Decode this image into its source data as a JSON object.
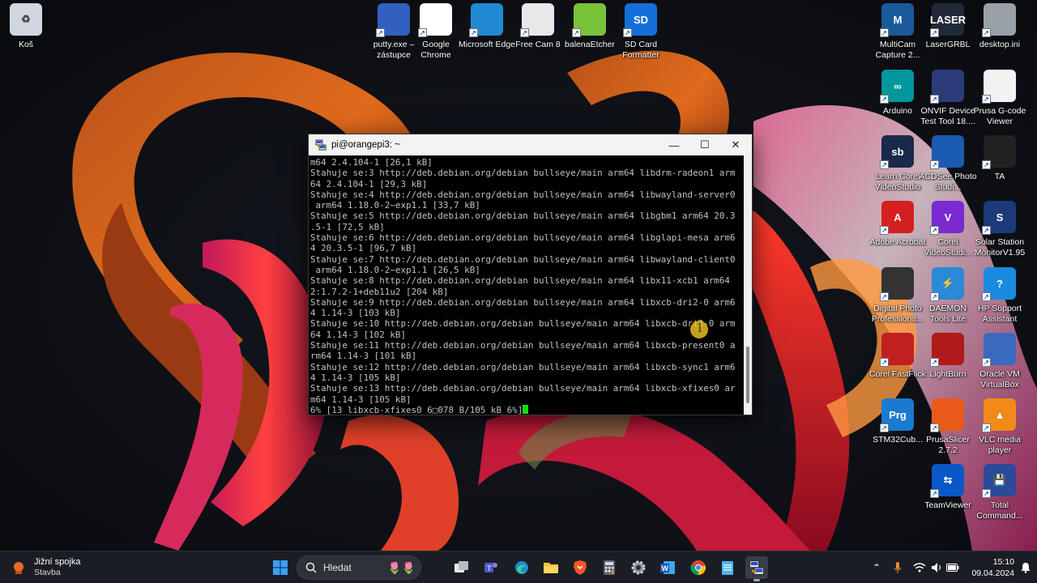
{
  "desktop": {
    "icons": [
      {
        "label": "Koš",
        "name": "recycle-bin-icon"
      },
      {
        "label": "putty.exe – zástupce",
        "name": "putty-icon"
      },
      {
        "label": "Google Chrome",
        "name": "chrome-icon"
      },
      {
        "label": "Microsoft Edge",
        "name": "edge-icon"
      },
      {
        "label": "Free Cam 8",
        "name": "freecam-icon"
      },
      {
        "label": "balenaEtcher",
        "name": "balena-etcher-icon"
      },
      {
        "label": "SD Card Formatter",
        "name": "sd-card-formatter-icon"
      },
      {
        "label": "MultiCam Capture 2...",
        "name": "multicam-icon"
      },
      {
        "label": "LaserGRBL",
        "name": "lasergrbl-icon"
      },
      {
        "label": "desktop.ini",
        "name": "file-icon"
      },
      {
        "label": "Arduino",
        "name": "arduino-icon"
      },
      {
        "label": "ONVIF Device Test Tool 18....",
        "name": "onvif-icon"
      },
      {
        "label": "Prusa G-code Viewer",
        "name": "prusa-gcode-viewer-icon"
      },
      {
        "label": "Learn Corel VideoStudio",
        "name": "learn-corel-icon"
      },
      {
        "label": "ACDSee Photo Studi...",
        "name": "acdsee-icon"
      },
      {
        "label": "TA",
        "name": "ta-icon"
      },
      {
        "label": "Adobe Acrobat",
        "name": "acrobat-icon"
      },
      {
        "label": "Corel VideoStudi...",
        "name": "corel-videostudio-icon"
      },
      {
        "label": "Solar Station MonitorV1.95",
        "name": "solar-station-icon"
      },
      {
        "label": "Digital Photo Professiona...",
        "name": "digital-photo-icon"
      },
      {
        "label": "DAEMON Tools Lite",
        "name": "daemon-tools-icon"
      },
      {
        "label": "HP Support Assistant",
        "name": "hp-support-icon"
      },
      {
        "label": "Corel FastFlick",
        "name": "corel-fastflick-icon"
      },
      {
        "label": "LightBurn",
        "name": "lightburn-icon"
      },
      {
        "label": "Oracle VM VirtualBox",
        "name": "virtualbox-icon"
      },
      {
        "label": "STM32Cub...",
        "name": "stm32cube-icon"
      },
      {
        "label": "PrusaSlicer 2.7.2",
        "name": "prusaslicer-icon"
      },
      {
        "label": "VLC media player",
        "name": "vlc-icon"
      },
      {
        "label": "TeamViewer",
        "name": "teamviewer-icon"
      },
      {
        "label": "Total Command...",
        "name": "total-commander-icon"
      }
    ]
  },
  "terminal": {
    "title": "pi@orangepi3: ~",
    "lines": [
      "m64 2.4.104-1 [26,1 kB]",
      "Stahuje se:3 http://deb.debian.org/debian bullseye/main arm64 libdrm-radeon1 arm",
      "64 2.4.104-1 [29,3 kB]",
      "Stahuje se:4 http://deb.debian.org/debian bullseye/main arm64 libwayland-server0",
      " arm64 1.18.0-2~exp1.1 [33,7 kB]",
      "Stahuje se:5 http://deb.debian.org/debian bullseye/main arm64 libgbm1 arm64 20.3",
      ".5-1 [72,5 kB]",
      "Stahuje se:6 http://deb.debian.org/debian bullseye/main arm64 libglapi-mesa arm6",
      "4 20.3.5-1 [96,7 kB]",
      "Stahuje se:7 http://deb.debian.org/debian bullseye/main arm64 libwayland-client0",
      " arm64 1.18.0-2~exp1.1 [26,5 kB]",
      "Stahuje se:8 http://deb.debian.org/debian bullseye/main arm64 libx11-xcb1 arm64",
      "2:1.7.2-1+deb11u2 [204 kB]",
      "Stahuje se:9 http://deb.debian.org/debian bullseye/main arm64 libxcb-dri2-0 arm6",
      "4 1.14-3 [103 kB]",
      "Stahuje se:10 http://deb.debian.org/debian bullseye/main arm64 libxcb-dri3-0 arm",
      "64 1.14-3 [102 kB]",
      "Stahuje se:11 http://deb.debian.org/debian bullseye/main arm64 libxcb-present0 a",
      "rm64 1.14-3 [101 kB]",
      "Stahuje se:12 http://deb.debian.org/debian bullseye/main arm64 libxcb-sync1 arm6",
      "4 1.14-3 [105 kB]",
      "Stahuje se:13 http://deb.debian.org/debian bullseye/main arm64 libxcb-xfixes0 ar",
      "m64 1.14-3 [105 kB]"
    ],
    "progress_line": "6% [13 libxcb-xfixes0 6\u0000078 B/105 kB 6%]"
  },
  "taskbar": {
    "weather_title": "Jižní spojka",
    "weather_sub": "Stavba",
    "search_placeholder": "Hledat",
    "time": "15:10",
    "date": "09.04.2024",
    "apps": [
      {
        "name": "start-icon"
      },
      {
        "name": "task-view-icon"
      },
      {
        "name": "teams-icon"
      },
      {
        "name": "edge-taskbar-icon"
      },
      {
        "name": "file-explorer-icon"
      },
      {
        "name": "brave-icon"
      },
      {
        "name": "calculator-icon"
      },
      {
        "name": "settings-icon"
      },
      {
        "name": "word-icon"
      },
      {
        "name": "chrome-taskbar-icon"
      },
      {
        "name": "notepad-icon"
      },
      {
        "name": "putty-taskbar-icon"
      }
    ]
  },
  "colors": {
    "terminal_text": "#c0c0c0",
    "cursor": "#10e010",
    "taskbar": "#1c1e26"
  }
}
